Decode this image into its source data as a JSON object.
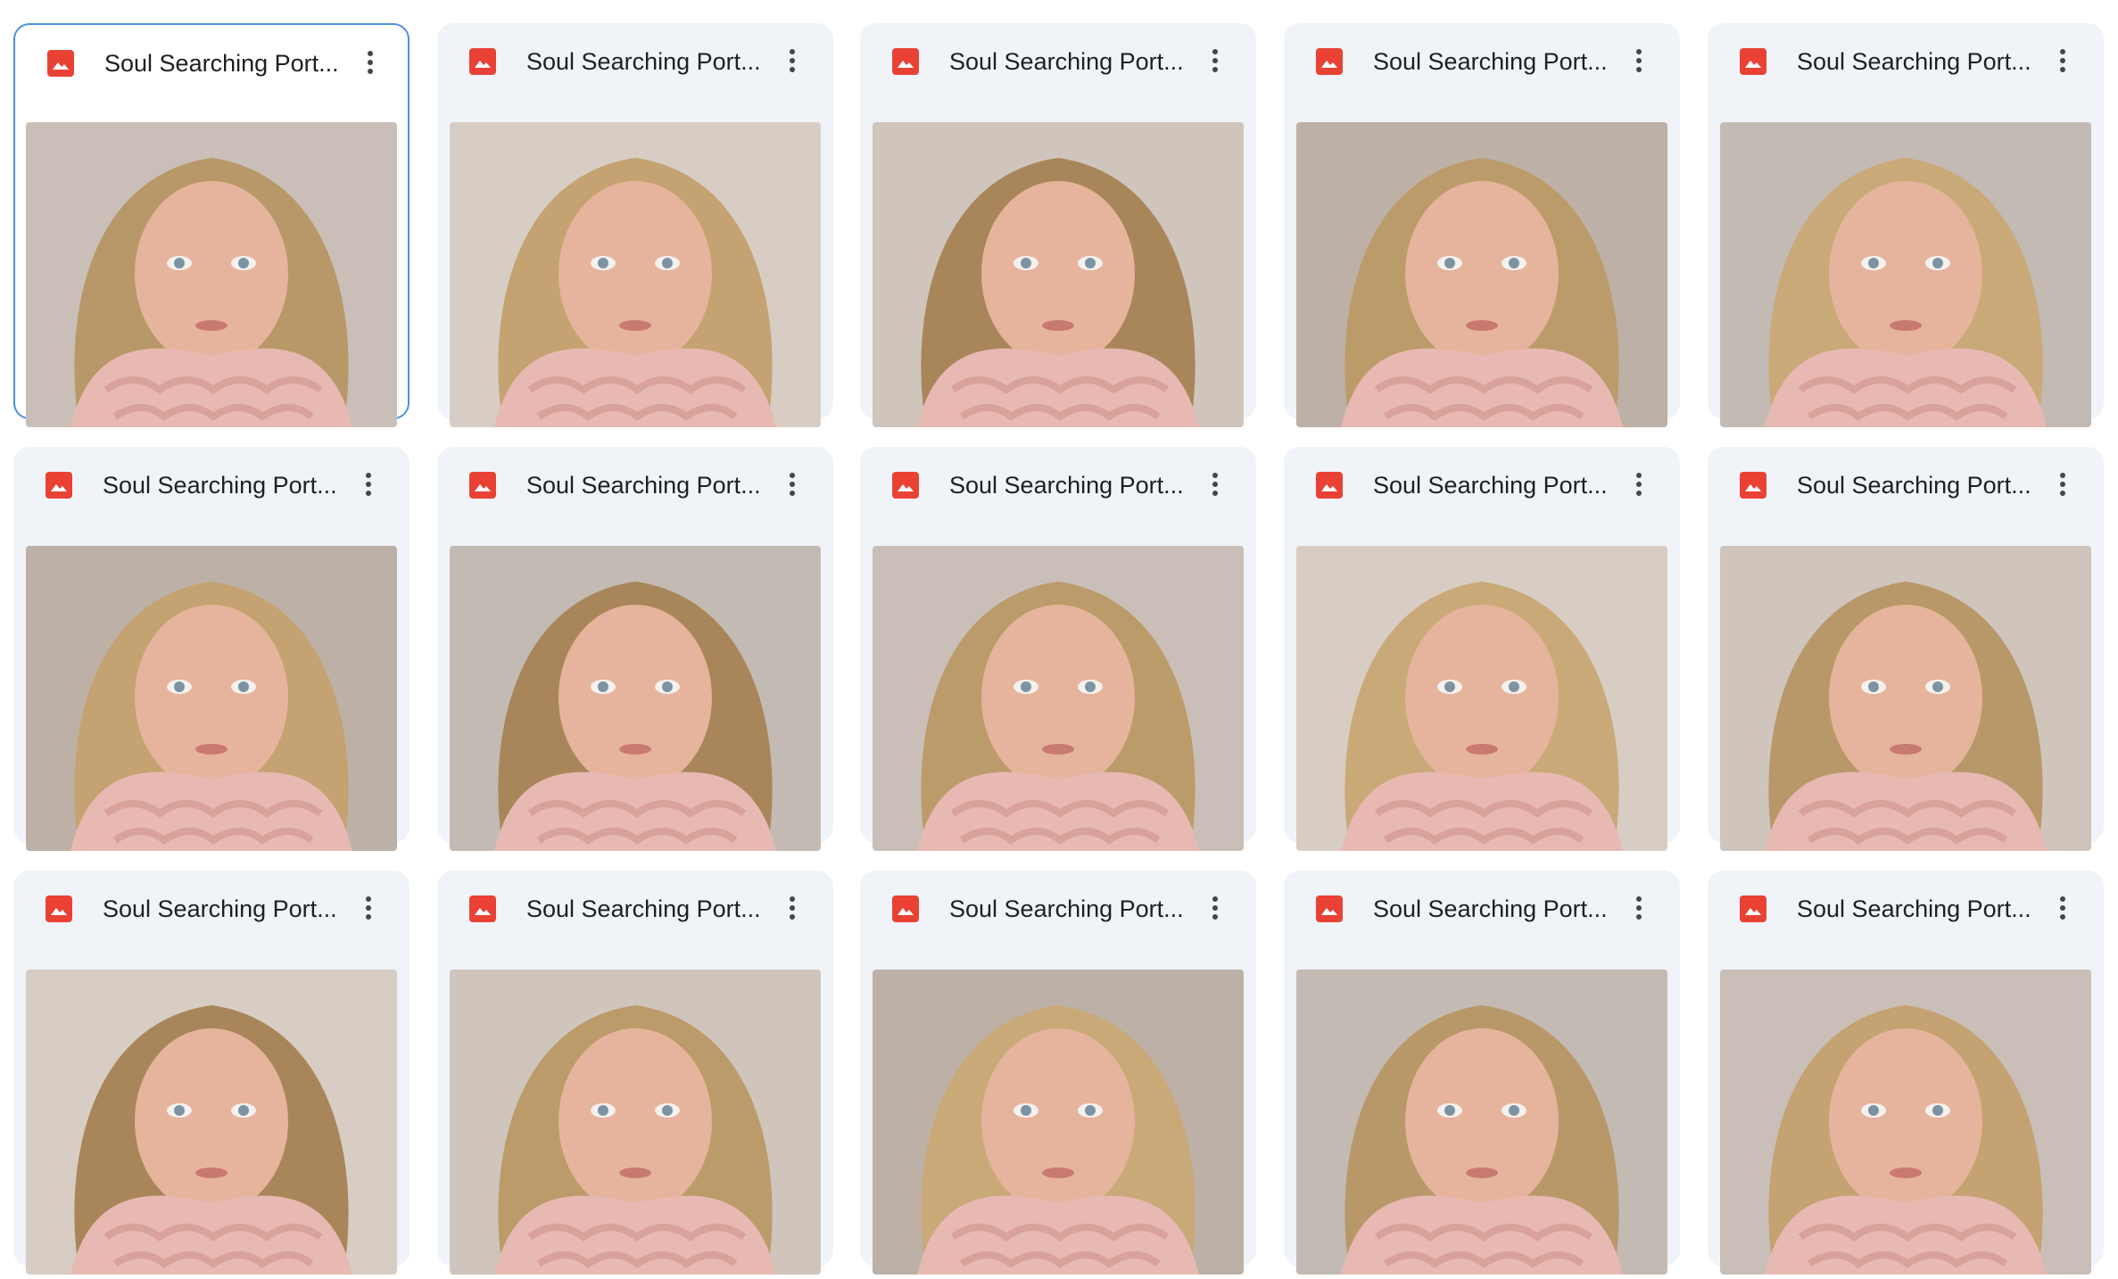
{
  "colors": {
    "card_bg": "#f0f4f9",
    "selected_border": "#4d8fe3",
    "file_icon": "#e94235",
    "title_text": "#1f1f1f"
  },
  "files": [
    {
      "title": "Soul Searching Port...",
      "icon": "image-file-icon",
      "menu_icon": "more-vert-icon",
      "selected": true
    },
    {
      "title": "Soul Searching Port...",
      "icon": "image-file-icon",
      "menu_icon": "more-vert-icon",
      "selected": false
    },
    {
      "title": "Soul Searching Port...",
      "icon": "image-file-icon",
      "menu_icon": "more-vert-icon",
      "selected": false
    },
    {
      "title": "Soul Searching Port...",
      "icon": "image-file-icon",
      "menu_icon": "more-vert-icon",
      "selected": false
    },
    {
      "title": "Soul Searching Port...",
      "icon": "image-file-icon",
      "menu_icon": "more-vert-icon",
      "selected": false
    },
    {
      "title": "Soul Searching Port...",
      "icon": "image-file-icon",
      "menu_icon": "more-vert-icon",
      "selected": false
    },
    {
      "title": "Soul Searching Port...",
      "icon": "image-file-icon",
      "menu_icon": "more-vert-icon",
      "selected": false
    },
    {
      "title": "Soul Searching Port...",
      "icon": "image-file-icon",
      "menu_icon": "more-vert-icon",
      "selected": false
    },
    {
      "title": "Soul Searching Port...",
      "icon": "image-file-icon",
      "menu_icon": "more-vert-icon",
      "selected": false
    },
    {
      "title": "Soul Searching Port...",
      "icon": "image-file-icon",
      "menu_icon": "more-vert-icon",
      "selected": false
    },
    {
      "title": "Soul Searching Port...",
      "icon": "image-file-icon",
      "menu_icon": "more-vert-icon",
      "selected": false
    },
    {
      "title": "Soul Searching Port...",
      "icon": "image-file-icon",
      "menu_icon": "more-vert-icon",
      "selected": false
    },
    {
      "title": "Soul Searching Port...",
      "icon": "image-file-icon",
      "menu_icon": "more-vert-icon",
      "selected": false
    },
    {
      "title": "Soul Searching Port...",
      "icon": "image-file-icon",
      "menu_icon": "more-vert-icon",
      "selected": false
    },
    {
      "title": "Soul Searching Port...",
      "icon": "image-file-icon",
      "menu_icon": "more-vert-icon",
      "selected": false
    }
  ]
}
